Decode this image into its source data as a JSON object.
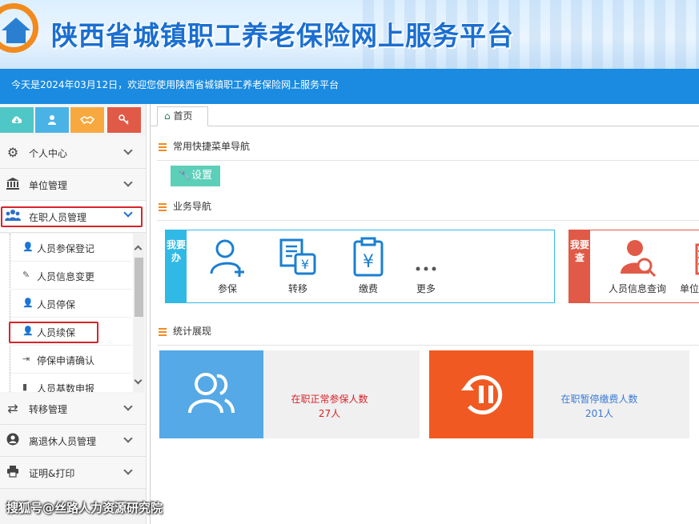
{
  "header": {
    "title": "陕西省城镇职工养老保险网上服务平台",
    "banner_text": "今天是2024年03月12日，欢迎您使用陕西省城镇职工养老保险网上服务平台"
  },
  "quick_buttons": [
    {
      "icon": "cloud-download-icon",
      "color": "#4fc7c7"
    },
    {
      "icon": "user-icon",
      "color": "#4ab3e6"
    },
    {
      "icon": "handshake-icon",
      "color": "#f7a940"
    },
    {
      "icon": "key-icon",
      "color": "#e05a47"
    }
  ],
  "sidebar": {
    "items": [
      {
        "label": "个人中心",
        "icon": "gear-icon"
      },
      {
        "label": "单位管理",
        "icon": "building-icon"
      },
      {
        "label": "在职人员管理",
        "icon": "users-icon"
      },
      {
        "label": "转移管理",
        "icon": "transfer-icon"
      },
      {
        "label": "离退休人员管理",
        "icon": "retiree-icon"
      },
      {
        "label": "证明&打印",
        "icon": "printer-icon"
      }
    ],
    "submenu": [
      {
        "label": "人员参保登记"
      },
      {
        "label": "人员信息变更"
      },
      {
        "label": "人员停保"
      },
      {
        "label": "人员续保"
      },
      {
        "label": "停保申请确认"
      },
      {
        "label": "人员基数申报"
      }
    ]
  },
  "main": {
    "tab_label": "首页",
    "section_shortcut": "常用快捷菜单导航",
    "settings_label": "设置",
    "section_business": "业务导航",
    "box_do": {
      "tag": "我要办",
      "items": [
        {
          "label": "参保",
          "icon": "user-add-icon"
        },
        {
          "label": "转移",
          "icon": "transfer-doc-icon"
        },
        {
          "label": "缴费",
          "icon": "payment-clipboard-icon"
        },
        {
          "label": "更多",
          "icon": "more-dots-icon"
        }
      ]
    },
    "box_query": {
      "tag": "我要查",
      "items": [
        {
          "label": "人员信息查询",
          "icon": "user-search-icon"
        },
        {
          "label": "单位",
          "icon": "building-query-icon"
        }
      ]
    },
    "section_stats": "统计展现",
    "stats": [
      {
        "label": "在职正常参保人数",
        "value": "27人",
        "icon": "users-icon",
        "icon_color": "#55a9e6",
        "text_color": "#d9232a"
      },
      {
        "label": "在职暂停缴费人数",
        "value": "201人",
        "icon": "pause-history-icon",
        "icon_color": "#f05a22",
        "text_color": "#3a7bd5"
      }
    ]
  },
  "watermark": "搜狐号@丝路人力资源研究院",
  "colors": {
    "banner": "#1a8be0",
    "do_box": "#31b9e6",
    "query_box": "#e05a47",
    "title": "#1a6fd1"
  }
}
